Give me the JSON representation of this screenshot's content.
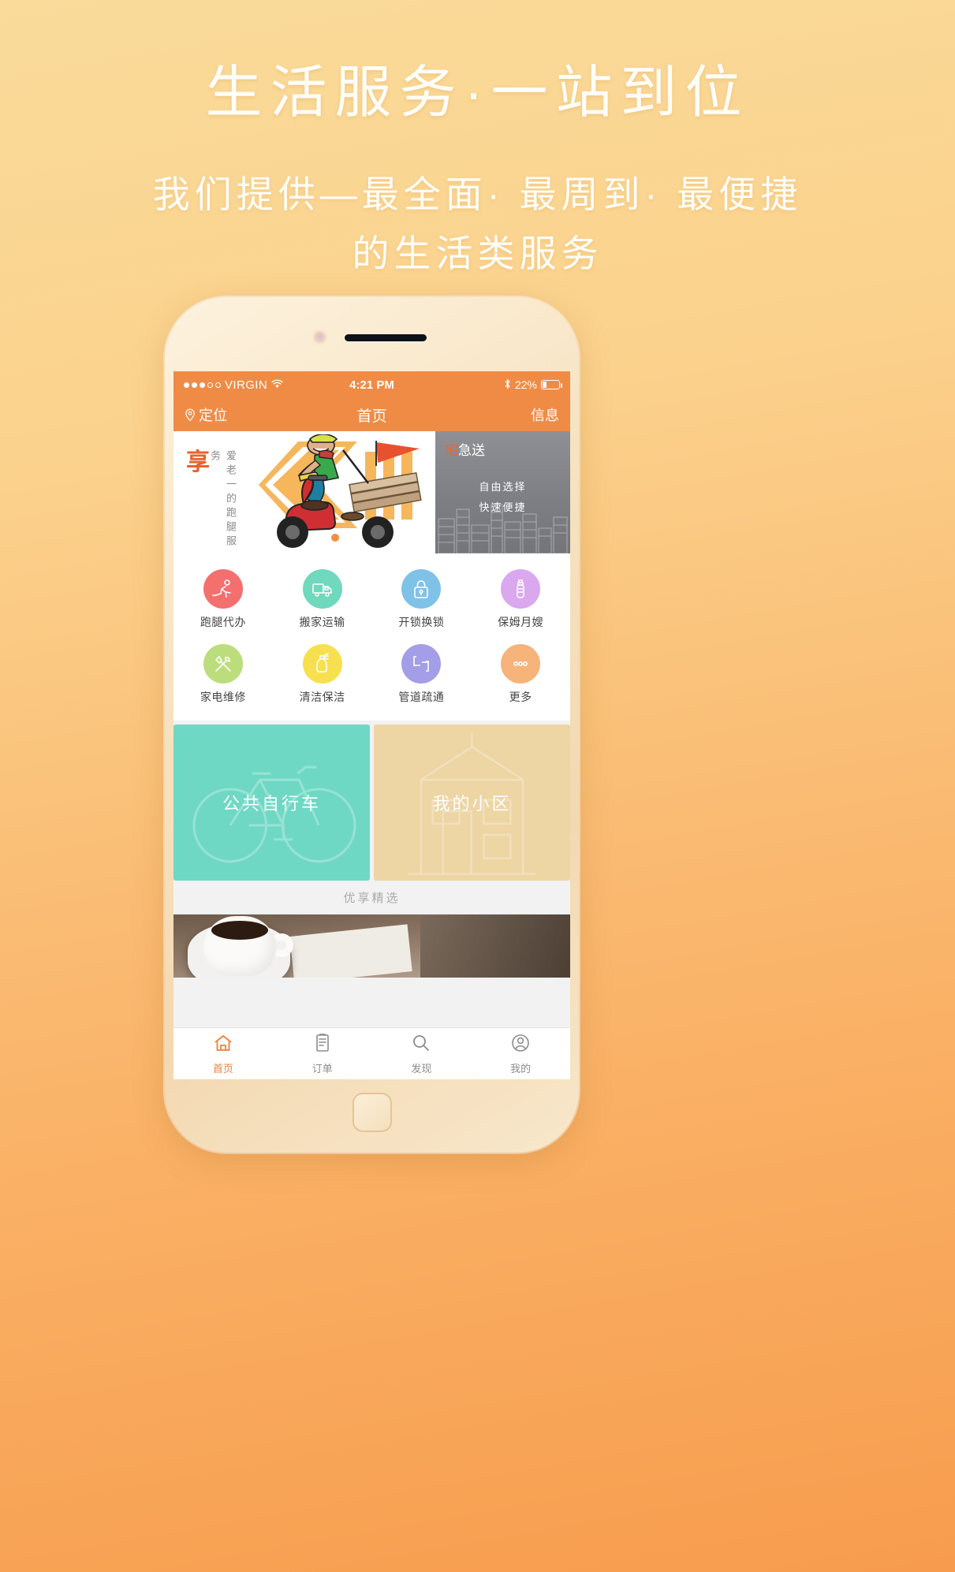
{
  "poster": {
    "title": "生活服务·一站到位",
    "subtitle_line1": "我们提供—最全面·  最周到·  最便捷",
    "subtitle_line2": "的生活类服务"
  },
  "theme": {
    "bg_start": "#fadb9a",
    "bg_end": "#f79c4e",
    "accent": "#f08b45",
    "tab_active": "#ef7f3c"
  },
  "phone": {
    "status_bar": {
      "signal_dots_filled": 3,
      "signal_dots_total": 5,
      "carrier": "VIRGIN",
      "wifi_icon": "wifi-icon",
      "time": "4:21 PM",
      "bluetooth_icon": "bluetooth-icon",
      "battery_percent": "22%",
      "battery_icon": "battery-icon"
    },
    "nav_bar": {
      "left_icon": "location-pin-icon",
      "left_label": "定位",
      "title": "首页",
      "right_label": "信息"
    },
    "banner": {
      "main": {
        "badge": "享",
        "vertical_text": "爱老一的跑腿服务",
        "illustration": "scooter-delivery-illustration"
      },
      "side": {
        "title_highlight": "宅",
        "title_rest": "急送",
        "line1": "自由选择",
        "line2": "快速便捷",
        "art": "city-skyline-art"
      }
    },
    "services": [
      {
        "label": "跑腿代办",
        "icon": "running-person-icon",
        "color": "#f4706f"
      },
      {
        "label": "搬家运输",
        "icon": "moving-truck-icon",
        "color": "#6fd8bd"
      },
      {
        "label": "开锁换锁",
        "icon": "padlock-icon",
        "color": "#7fc2e8"
      },
      {
        "label": "保姆月嫂",
        "icon": "baby-bottle-icon",
        "color": "#d9a8ef"
      },
      {
        "label": "家电维修",
        "icon": "tools-icon",
        "color": "#bcdd7c"
      },
      {
        "label": "清洁保洁",
        "icon": "spray-bottle-icon",
        "color": "#f7e04f"
      },
      {
        "label": "管道疏通",
        "icon": "pipe-icon",
        "color": "#a49de8"
      },
      {
        "label": "更多",
        "icon": "ellipsis-icon",
        "color": "#f6b37a"
      }
    ],
    "cards": [
      {
        "label": "公共自行车",
        "art": "bicycle-outline-art",
        "color": "#6fd8c4"
      },
      {
        "label": "我的小区",
        "art": "building-outline-art",
        "color": "#edd5a4"
      }
    ],
    "section_divider": "优享精选",
    "photo_strip": "coffee-cup-photo",
    "tabs": [
      {
        "label": "首页",
        "icon": "home-icon",
        "active": true
      },
      {
        "label": "订单",
        "icon": "order-list-icon",
        "active": false
      },
      {
        "label": "发现",
        "icon": "magnifier-icon",
        "active": false
      },
      {
        "label": "我的",
        "icon": "user-profile-icon",
        "active": false
      }
    ]
  }
}
